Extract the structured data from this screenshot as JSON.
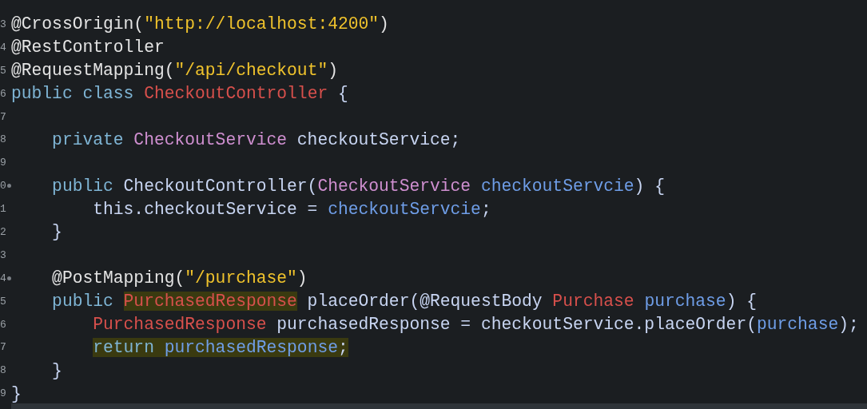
{
  "editor": {
    "lines": [
      {
        "number": "3",
        "fold": false,
        "tokens": [
          {
            "text": "@CrossOrigin(",
            "kind": "annotation",
            "marked": false
          },
          {
            "text": "\"http://localhost:4200\"",
            "kind": "string",
            "marked": false
          },
          {
            "text": ")",
            "kind": "annotation",
            "marked": false
          }
        ]
      },
      {
        "number": "4",
        "fold": false,
        "tokens": [
          {
            "text": "@RestController",
            "kind": "annotation",
            "marked": false
          }
        ]
      },
      {
        "number": "5",
        "fold": false,
        "tokens": [
          {
            "text": "@RequestMapping(",
            "kind": "annotation",
            "marked": false
          },
          {
            "text": "\"/api/checkout\"",
            "kind": "string",
            "marked": false
          },
          {
            "text": ")",
            "kind": "annotation",
            "marked": false
          }
        ]
      },
      {
        "number": "6",
        "fold": false,
        "tokens": [
          {
            "text": "public class",
            "kind": "keyword",
            "marked": false
          },
          {
            "text": " CheckoutController",
            "kind": "type",
            "marked": false
          },
          {
            "text": " {",
            "kind": "plain",
            "marked": false
          }
        ],
        "children": [
          {
            "number": "7",
            "fold": false
          },
          {
            "number": "8",
            "fold": false,
            "tokens": [
              {
                "text": "private",
                "kind": "keyword",
                "marked": false
              },
              {
                "text": " CheckoutService",
                "kind": "field_type",
                "marked": false
              },
              {
                "text": " checkoutService;",
                "kind": "plain",
                "marked": false
              }
            ]
          },
          {
            "number": "9",
            "fold": false
          },
          {
            "number": "0",
            "fold": true,
            "tokens": [
              {
                "text": "public",
                "kind": "keyword",
                "marked": false
              },
              {
                "text": " CheckoutController(",
                "kind": "plain",
                "marked": false
              },
              {
                "text": "CheckoutService",
                "kind": "field_type",
                "marked": false
              },
              {
                "text": " checkoutServcie",
                "kind": "param",
                "marked": false
              },
              {
                "text": ") {",
                "kind": "plain",
                "marked": false
              }
            ],
            "children": [
              {
                "number": "1",
                "fold": false,
                "tokens": [
                  {
                    "text": "this.checkoutService = ",
                    "kind": "plain",
                    "marked": false
                  },
                  {
                    "text": "checkoutServcie",
                    "kind": "param",
                    "marked": false
                  },
                  {
                    "text": ";",
                    "kind": "plain",
                    "marked": false
                  }
                ]
              }
            ]
          },
          {
            "number": "2",
            "fold": false,
            "tokens": [
              {
                "text": "}",
                "kind": "plain",
                "marked": false
              }
            ]
          },
          {
            "number": "3",
            "fold": false
          },
          {
            "number": "4",
            "fold": true,
            "tokens": [
              {
                "text": "@PostMapping(",
                "kind": "annotation",
                "marked": false
              },
              {
                "text": "\"/purchase\"",
                "kind": "string",
                "marked": false
              },
              {
                "text": ")",
                "kind": "annotation",
                "marked": false
              }
            ]
          },
          {
            "number": "5",
            "fold": false,
            "tokens": [
              {
                "text": "public ",
                "kind": "keyword",
                "marked": false
              },
              {
                "text": "PurchasedResponse",
                "kind": "type",
                "marked": true
              },
              {
                "text": " placeOrder(@RequestBody ",
                "kind": "plain",
                "marked": false
              },
              {
                "text": "Purchase",
                "kind": "type",
                "marked": false
              },
              {
                "text": " purchase",
                "kind": "param",
                "marked": false
              },
              {
                "text": ") {",
                "kind": "plain",
                "marked": false
              }
            ],
            "children": [
              {
                "number": "6",
                "fold": false,
                "tokens": [
                  {
                    "text": "PurchasedResponse",
                    "kind": "type",
                    "marked": false
                  },
                  {
                    "text": " purchasedResponse = checkoutService.placeOrder(",
                    "kind": "plain",
                    "marked": false
                  },
                  {
                    "text": "purchase",
                    "kind": "param",
                    "marked": false
                  },
                  {
                    "text": ");",
                    "kind": "plain",
                    "marked": false
                  }
                ]
              },
              {
                "number": "7",
                "fold": false,
                "tokens": [
                  {
                    "text": "return ",
                    "kind": "keyword",
                    "marked": true
                  },
                  {
                    "text": "purchasedResponse",
                    "kind": "param",
                    "marked": true
                  },
                  {
                    "text": ";",
                    "kind": "plain",
                    "marked": true
                  }
                ]
              }
            ]
          },
          {
            "number": "8",
            "fold": false,
            "tokens": [
              {
                "text": "}",
                "kind": "plain",
                "marked": false
              }
            ]
          }
        ]
      },
      {
        "number": "9",
        "fold": false,
        "tokens": [
          {
            "text": "}",
            "kind": "plain",
            "marked": false
          }
        ]
      }
    ]
  }
}
